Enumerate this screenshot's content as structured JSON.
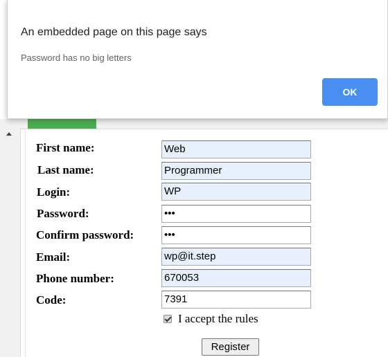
{
  "dialog": {
    "title": "An embedded page on this page says",
    "message": "Password has no big letters",
    "ok_label": "OK"
  },
  "form": {
    "fields": [
      {
        "label": "First name:",
        "value": "Web",
        "autofill": true
      },
      {
        "label": "Last name:",
        "value": "Programmer",
        "autofill": true
      },
      {
        "label": "Login:",
        "value": "WP",
        "autofill": true
      },
      {
        "label": "Password:",
        "value": "•••",
        "autofill": false
      },
      {
        "label": "Confirm password:",
        "value": "•••",
        "autofill": false
      },
      {
        "label": "Email:",
        "value": "wp@it.step",
        "autofill": true
      },
      {
        "label": "Phone number:",
        "value": "670053",
        "autofill": true
      },
      {
        "label": "Code:",
        "value": "7391",
        "autofill": false
      }
    ],
    "accept_label": "I accept the rules",
    "accept_checked": true,
    "register_label": "Register"
  },
  "colors": {
    "autofill_bg": "#e8f0fe",
    "ok_button": "#4a8ef2",
    "progress_green": "#4caf50"
  }
}
